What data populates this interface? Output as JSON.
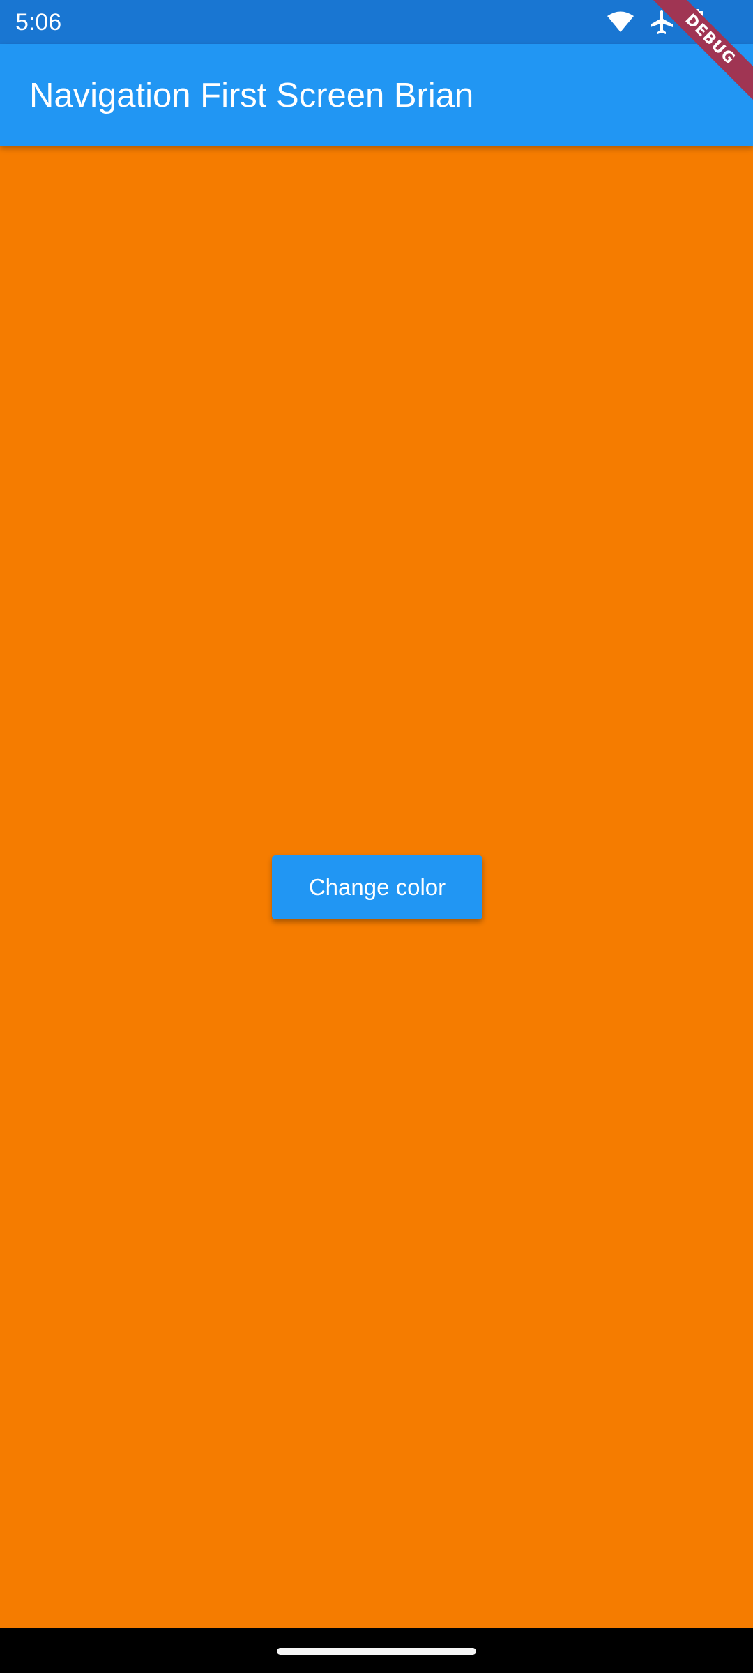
{
  "status_bar": {
    "time": "5:06",
    "icons": [
      "wifi-icon",
      "airplane-icon",
      "battery-icon"
    ],
    "background": "#1976D2"
  },
  "debug_banner": {
    "label": "DEBUG",
    "color": "#A03553"
  },
  "app_bar": {
    "title": "Navigation First Screen Brian",
    "background": "#2196F3"
  },
  "body": {
    "background": "#F57C00",
    "change_color_button": {
      "label": "Change color",
      "background": "#2196F3"
    }
  },
  "nav_bar": {
    "handle": "home-handle"
  }
}
